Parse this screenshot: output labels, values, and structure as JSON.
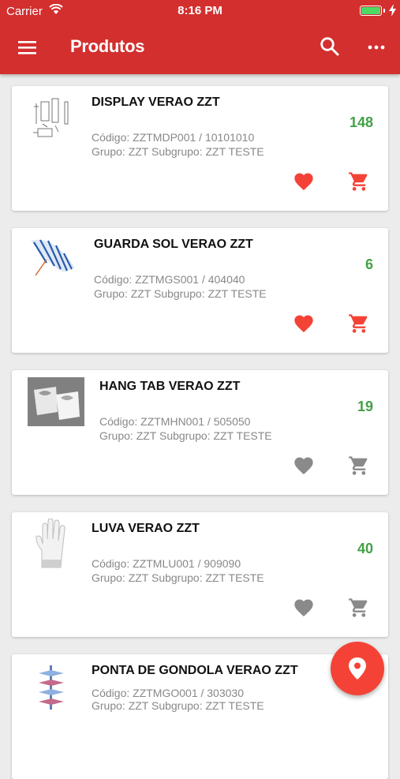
{
  "status_bar": {
    "carrier": "Carrier",
    "time": "8:16 PM"
  },
  "header": {
    "title": "Produtos",
    "background": "#d32f2f"
  },
  "colors": {
    "quantity": "#43a047",
    "active_action": "#f44336",
    "inactive_action": "#8a8a8a"
  },
  "products": [
    {
      "name": "DISPLAY VERAO ZZT",
      "code_line": "Código: ZZTMDP001 / 10101010",
      "group_line": "Grupo: ZZT Subgrupo: ZZT TESTE",
      "quantity": "148",
      "favorite_active": true,
      "cart_active": true,
      "image_icon": "display-drawing-icon"
    },
    {
      "name": "GUARDA SOL VERAO ZZT",
      "code_line": "Código: ZZTMGS001 / 404040",
      "group_line": "Grupo: ZZT Subgrupo: ZZT TESTE",
      "quantity": "6",
      "favorite_active": true,
      "cart_active": true,
      "image_icon": "umbrella-icon"
    },
    {
      "name": "HANG TAB VERAO ZZT",
      "code_line": "Código: ZZTMHN001 / 505050",
      "group_line": "Grupo: ZZT Subgrupo: ZZT TESTE",
      "quantity": "19",
      "favorite_active": false,
      "cart_active": false,
      "image_icon": "hang-tab-icon"
    },
    {
      "name": "LUVA VERAO ZZT",
      "code_line": "Código: ZZTMLU001 / 909090",
      "group_line": "Grupo: ZZT Subgrupo: ZZT TESTE",
      "quantity": "40",
      "favorite_active": false,
      "cart_active": false,
      "image_icon": "glove-icon"
    },
    {
      "name": "PONTA DE GONDOLA VERAO ZZT",
      "code_line": "Código: ZZTMGO001 / 303030",
      "group_line": "Grupo: ZZT Subgrupo: ZZT TESTE",
      "quantity": "",
      "favorite_active": false,
      "cart_active": false,
      "image_icon": "gondola-icon"
    }
  ],
  "fab": {
    "icon": "location-pin-icon"
  }
}
